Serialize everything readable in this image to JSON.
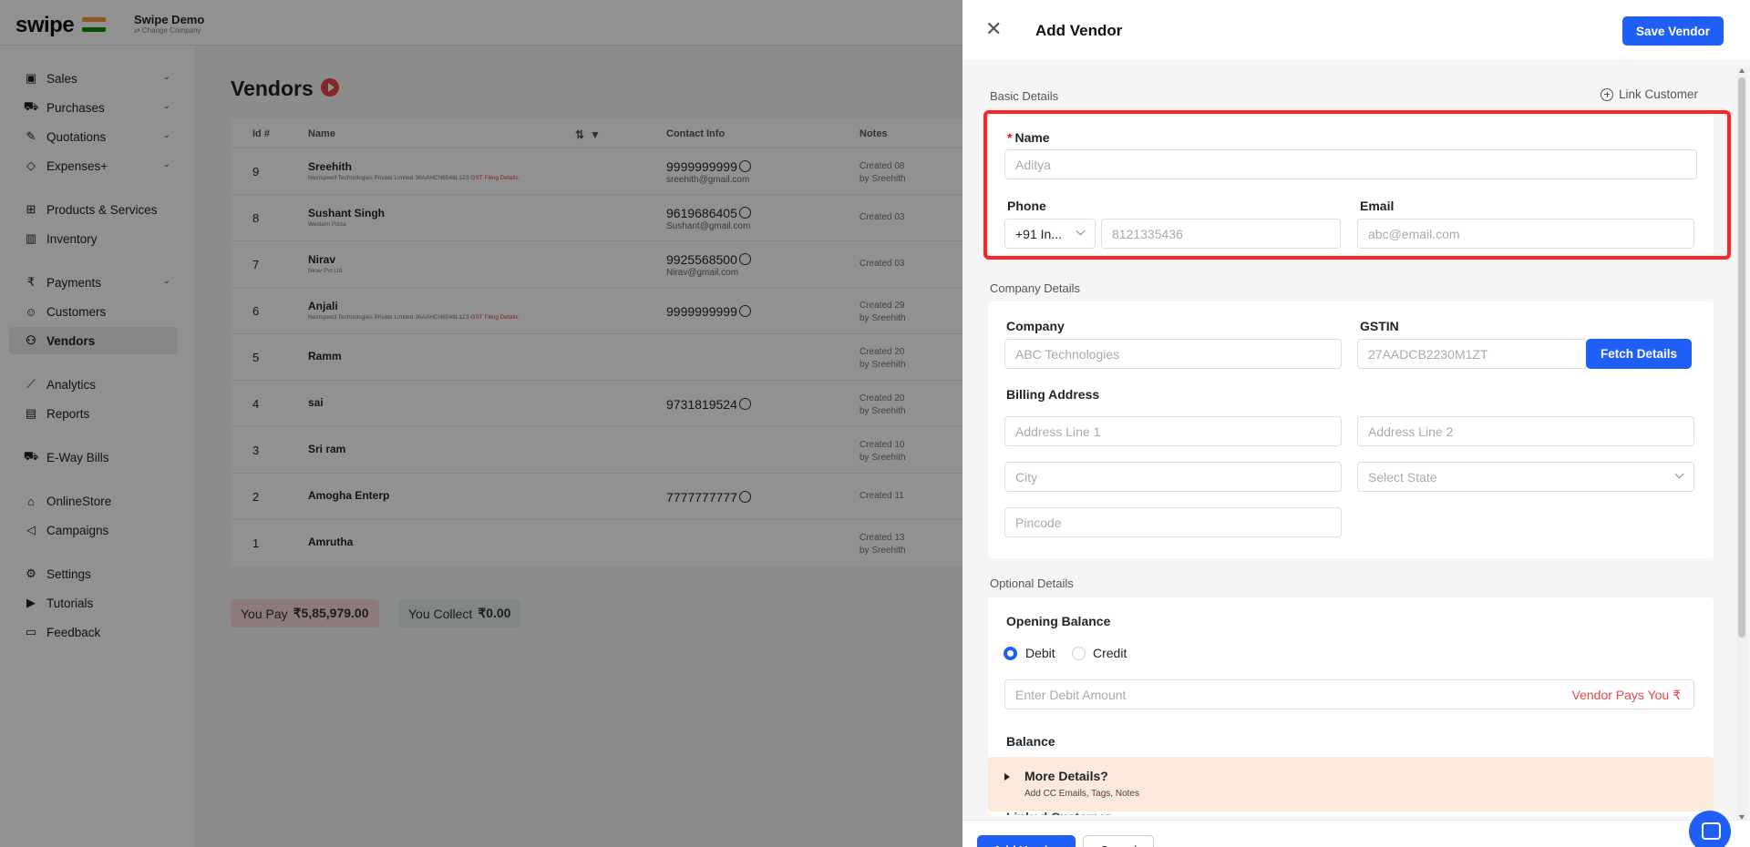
{
  "app": {
    "logo": "swipe",
    "company_name": "Swipe Demo",
    "company_sub": "⇄ Change Company"
  },
  "sidebar": {
    "items": [
      {
        "label": "Sales",
        "icon": "sales-icon",
        "chevron": true
      },
      {
        "label": "Purchases",
        "icon": "cart-icon",
        "chevron": true
      },
      {
        "label": "Quotations",
        "icon": "pen-icon",
        "chevron": true
      },
      {
        "label": "Expenses+",
        "icon": "tag-icon",
        "chevron": true
      },
      {
        "label": "Products & Services",
        "icon": "box-icon"
      },
      {
        "label": "Inventory",
        "icon": "inventory-icon"
      },
      {
        "label": "Payments",
        "icon": "rupee-icon",
        "chevron": true
      },
      {
        "label": "Customers",
        "icon": "user-icon"
      },
      {
        "label": "Vendors",
        "icon": "users-icon",
        "active": true
      },
      {
        "label": "Analytics",
        "icon": "chart-icon"
      },
      {
        "label": "Reports",
        "icon": "report-icon"
      },
      {
        "label": "E-Way Bills",
        "icon": "truck-icon"
      },
      {
        "label": "OnlineStore",
        "icon": "store-icon"
      },
      {
        "label": "Campaigns",
        "icon": "megaphone-icon"
      },
      {
        "label": "Settings",
        "icon": "gear-icon"
      },
      {
        "label": "Tutorials",
        "icon": "youtube-icon"
      },
      {
        "label": "Feedback",
        "icon": "message-icon"
      }
    ]
  },
  "vendors": {
    "title": "Vendors",
    "columns": [
      "Id #",
      "Name",
      "Contact Info",
      "Notes"
    ],
    "rows": [
      {
        "id": "9",
        "name": "Sreehith",
        "sub": "Nextspeed Technologies Private Limited 36AAHCN6548L1Z3",
        "sub_flag": "GST Filing Details",
        "phone": "9999999999",
        "email": "sreehith@gmail.com",
        "note1": "Created 08",
        "note2": "by Sreehith"
      },
      {
        "id": "8",
        "name": "Sushant Singh",
        "sub": "Western Pizza",
        "phone": "9619686405",
        "email": "Sushant@gmail.com",
        "note1": "Created 03"
      },
      {
        "id": "7",
        "name": "Nirav",
        "sub": "Nirav Pvt Ltd",
        "phone": "9925568500",
        "email": "Nirav@gmail.com",
        "note1": "Created 03"
      },
      {
        "id": "6",
        "name": "Anjali",
        "sub": "Nextspeed Technologies Private Limited 36AAHCN6548L1Z3",
        "sub_flag": "GST Filing Details",
        "phone": "9999999999",
        "note1": "Created 29",
        "note2": "by Sreehith"
      },
      {
        "id": "5",
        "name": "Ramm",
        "note1": "Created 20",
        "note2": "by Sreehith"
      },
      {
        "id": "4",
        "name": "sai",
        "phone": "9731819524",
        "note1": "Created 20",
        "note2": "by Sreehith"
      },
      {
        "id": "3",
        "name": "Sri ram",
        "note1": "Created 10",
        "note2": "by Sreehith"
      },
      {
        "id": "2",
        "name": "Amogha Enterp",
        "phone": "7777777777",
        "note1": "Created 11"
      },
      {
        "id": "1",
        "name": "Amrutha",
        "note1": "Created 13",
        "note2": "by Sreehith"
      }
    ],
    "you_pay_label": "You Pay",
    "you_pay_value": "₹5,85,979.00",
    "you_collect_label": "You Collect",
    "you_collect_value": "₹0.00"
  },
  "drawer": {
    "title": "Add Vendor",
    "save_label": "Save Vendor",
    "basic_details": "Basic Details",
    "link_customer": "Link Customer",
    "name_label": "Name",
    "name_placeholder": "Aditya",
    "phone_label": "Phone",
    "country_code": "+91  In...",
    "phone_placeholder": "8121335436",
    "email_label": "Email",
    "email_placeholder": "abc@email.com",
    "company_details": "Company Details",
    "company_label": "Company",
    "company_placeholder": "ABC Technologies",
    "gstin_label": "GSTIN",
    "gstin_placeholder": "27AADCB2230M1ZT",
    "fetch_label": "Fetch Details",
    "billing_label": "Billing Address",
    "address1_placeholder": "Address Line 1",
    "address2_placeholder": "Address Line 2",
    "city_placeholder": "City",
    "state_placeholder": "Select State",
    "pincode_placeholder": "Pincode",
    "optional_details": "Optional Details",
    "opening_balance": "Opening Balance",
    "debit_label": "Debit",
    "credit_label": "Credit",
    "debit_placeholder": "Enter Debit Amount",
    "vendor_pays": "Vendor Pays You ₹",
    "balance_label": "Balance",
    "more_title": "More Details?",
    "more_sub": "Add CC Emails, Tags, Notes",
    "linked_customer": "Linked Customer",
    "add_vendor_btn": "Add Vendor",
    "cancel_btn": "Cancel"
  },
  "colors": {
    "accent": "#1f5ff5",
    "highlight": "#ff2424",
    "danger": "#e5484d",
    "more_bg": "#fde8dc"
  }
}
